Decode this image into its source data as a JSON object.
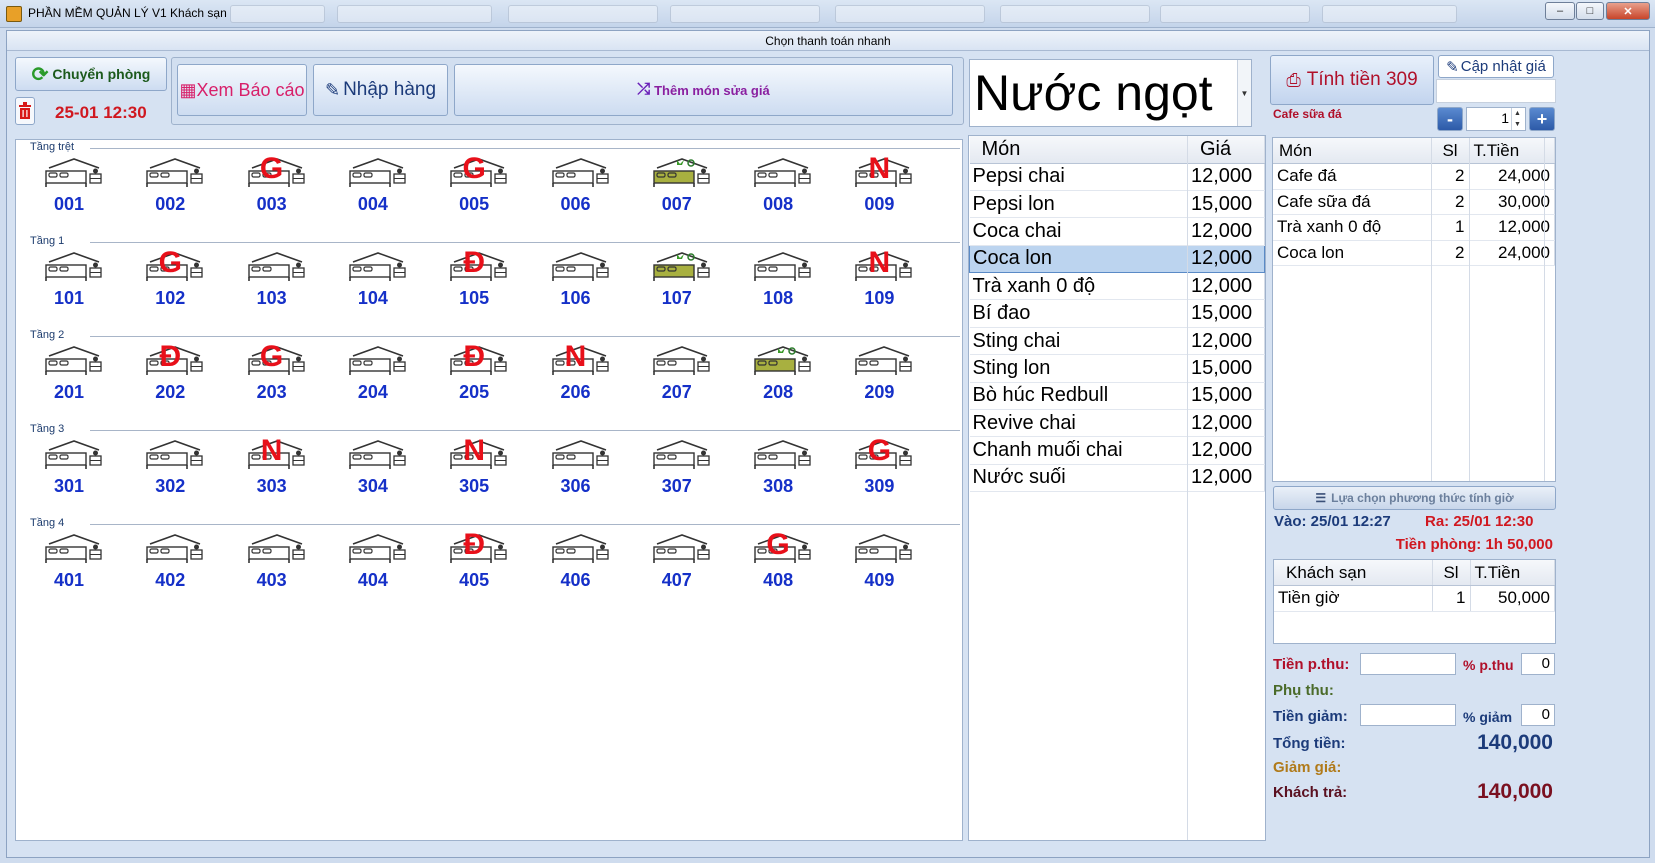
{
  "window": {
    "title": "PHẦN MỀM QUẢN LÝ V1 Khách sạn",
    "subtitle": "Chọn thanh toán nhanh",
    "min_label": "–",
    "max_label": "□",
    "close_label": "✕"
  },
  "toolbar": {
    "transfer_label": "Chuyển phòng",
    "datetime": "25-01 12:30",
    "report_label": "Xem Báo cáo",
    "import_label": "Nhập hàng",
    "add_item_label": "Thêm món sửa giá"
  },
  "category": {
    "selected": "Nước ngọt"
  },
  "floors": [
    {
      "label": "Tầng trệt",
      "rooms": [
        {
          "num": "001",
          "status": ""
        },
        {
          "num": "002",
          "status": ""
        },
        {
          "num": "003",
          "status": "G"
        },
        {
          "num": "004",
          "status": ""
        },
        {
          "num": "005",
          "status": "G"
        },
        {
          "num": "006",
          "status": ""
        },
        {
          "num": "007",
          "status": "",
          "clean": true
        },
        {
          "num": "008",
          "status": ""
        },
        {
          "num": "009",
          "status": "N"
        }
      ]
    },
    {
      "label": "Tầng 1",
      "rooms": [
        {
          "num": "101",
          "status": ""
        },
        {
          "num": "102",
          "status": "G"
        },
        {
          "num": "103",
          "status": ""
        },
        {
          "num": "104",
          "status": ""
        },
        {
          "num": "105",
          "status": "Đ"
        },
        {
          "num": "106",
          "status": ""
        },
        {
          "num": "107",
          "status": "",
          "clean": true
        },
        {
          "num": "108",
          "status": ""
        },
        {
          "num": "109",
          "status": "N"
        }
      ]
    },
    {
      "label": "Tầng 2",
      "rooms": [
        {
          "num": "201",
          "status": ""
        },
        {
          "num": "202",
          "status": "Đ"
        },
        {
          "num": "203",
          "status": "G"
        },
        {
          "num": "204",
          "status": ""
        },
        {
          "num": "205",
          "status": "Đ"
        },
        {
          "num": "206",
          "status": "N"
        },
        {
          "num": "207",
          "status": ""
        },
        {
          "num": "208",
          "status": "",
          "clean": true
        },
        {
          "num": "209",
          "status": ""
        }
      ]
    },
    {
      "label": "Tầng 3",
      "rooms": [
        {
          "num": "301",
          "status": ""
        },
        {
          "num": "302",
          "status": ""
        },
        {
          "num": "303",
          "status": "N"
        },
        {
          "num": "304",
          "status": ""
        },
        {
          "num": "305",
          "status": "N"
        },
        {
          "num": "306",
          "status": ""
        },
        {
          "num": "307",
          "status": ""
        },
        {
          "num": "308",
          "status": ""
        },
        {
          "num": "309",
          "status": "G"
        }
      ]
    },
    {
      "label": "Tầng 4",
      "rooms": [
        {
          "num": "401",
          "status": ""
        },
        {
          "num": "402",
          "status": ""
        },
        {
          "num": "403",
          "status": ""
        },
        {
          "num": "404",
          "status": ""
        },
        {
          "num": "405",
          "status": "Đ"
        },
        {
          "num": "406",
          "status": ""
        },
        {
          "num": "407",
          "status": ""
        },
        {
          "num": "408",
          "status": "G"
        },
        {
          "num": "409",
          "status": ""
        }
      ]
    }
  ],
  "menu": {
    "col_item": "Món",
    "col_price": "Giá",
    "selected_index": 3,
    "rows": [
      {
        "name": "Pepsi chai",
        "price": "12,000"
      },
      {
        "name": "Pepsi lon",
        "price": "15,000"
      },
      {
        "name": "Coca chai",
        "price": "12,000"
      },
      {
        "name": "Coca lon",
        "price": "12,000"
      },
      {
        "name": "Trà xanh 0 độ",
        "price": "12,000"
      },
      {
        "name": "Bí đao",
        "price": "15,000"
      },
      {
        "name": "Sting chai",
        "price": "12,000"
      },
      {
        "name": "Sting lon",
        "price": "15,000"
      },
      {
        "name": "Bò húc Redbull",
        "price": "15,000"
      },
      {
        "name": "Revive chai",
        "price": "12,000"
      },
      {
        "name": "Chanh muối chai",
        "price": "12,000"
      },
      {
        "name": "Nước suối",
        "price": "12,000"
      }
    ]
  },
  "billing": {
    "checkout_label": "Tính tiền 309",
    "update_price_label": "Cập nhật giá",
    "selected_item": "Cafe sữa đá",
    "qty_minus": "-",
    "qty_value": "1",
    "qty_plus": "+"
  },
  "order": {
    "col_item": "Món",
    "col_qty": "Sl",
    "col_total": "T.Tiền",
    "rows": [
      {
        "name": "Cafe đá",
        "qty": "2",
        "total": "24,000"
      },
      {
        "name": "Cafe sữa đá",
        "qty": "2",
        "total": "30,000"
      },
      {
        "name": "Trà xanh 0 độ",
        "qty": "1",
        "total": "12,000"
      },
      {
        "name": "Coca lon",
        "qty": "2",
        "total": "24,000"
      }
    ]
  },
  "time": {
    "method_label": "Lựa chọn phương thức tính giờ",
    "checkin": "Vào: 25/01 12:27",
    "checkout": "Ra: 25/01 12:30",
    "room_fee": "Tiền phòng: 1h 50,000"
  },
  "hotel": {
    "col_item": "Khách sạn",
    "col_qty": "Sl",
    "col_total": "T.Tiền",
    "rows": [
      {
        "name": "Tiền giờ",
        "qty": "1",
        "total": "50,000"
      }
    ]
  },
  "summary": {
    "surcharge_label": "Tiền p.thu:",
    "surcharge_pct_label": "% p.thu",
    "surcharge_pct_value": "0",
    "extra_label": "Phụ  thu:",
    "discount_label": "Tiền giảm:",
    "discount_pct_label": "% giảm",
    "discount_pct_value": "0",
    "total_label": "Tổng tiền:",
    "total_value": "140,000",
    "reduce_label": "Giảm  giá:",
    "pay_label": "Khách trả:",
    "pay_value": "140,000"
  }
}
